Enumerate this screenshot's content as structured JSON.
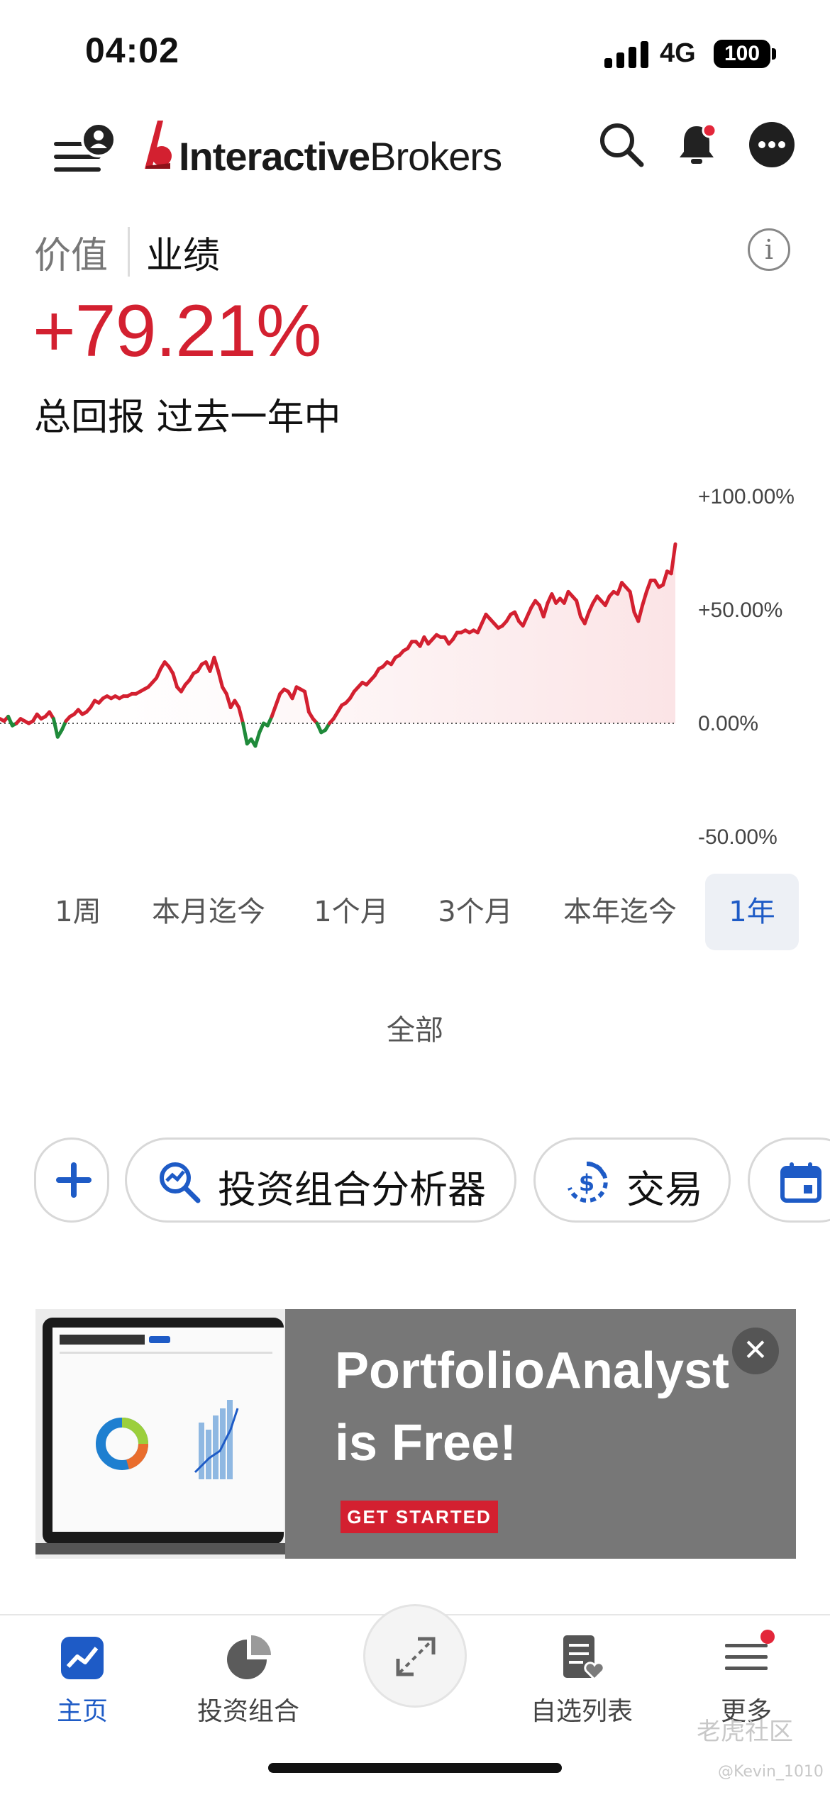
{
  "status_bar": {
    "time": "04:02",
    "network": "4G",
    "battery": "100"
  },
  "header": {
    "logo_bold": "Interactive",
    "logo_regular": "Brokers"
  },
  "tabs": {
    "value_label": "价值",
    "performance_label": "业绩"
  },
  "summary": {
    "return_value": "+79.21%",
    "description": "总回报 过去一年中"
  },
  "chart_data": {
    "type": "line",
    "y_tick_labels": [
      "+100.00%",
      "+50.00%",
      "0.00%",
      "-50.00%"
    ],
    "ylim": [
      -50,
      100
    ],
    "baseline": 0,
    "series": [
      {
        "values": [
          2,
          1,
          3,
          -1,
          0,
          2,
          1,
          0,
          1,
          4,
          2,
          3,
          5,
          2,
          -6,
          -3,
          1,
          3,
          4,
          6,
          4,
          5,
          7,
          10,
          9,
          11,
          12,
          11,
          12,
          11,
          12,
          12,
          13,
          13,
          14,
          15,
          16,
          18,
          20,
          24,
          27,
          25,
          22,
          16,
          14,
          17,
          19,
          22,
          23,
          26,
          27,
          23,
          29,
          23,
          16,
          13,
          7,
          10,
          7,
          0,
          -9,
          -7,
          -10,
          -4,
          0,
          -1,
          3,
          8,
          13,
          15,
          14,
          11,
          16,
          15,
          14,
          5,
          2,
          0,
          -4,
          -3,
          0,
          2,
          5,
          8,
          9,
          11,
          14,
          16,
          18,
          17,
          19,
          21,
          24,
          25,
          27,
          26,
          29,
          30,
          32,
          33,
          36,
          36,
          34,
          38,
          35,
          37,
          39,
          38,
          38,
          35,
          37,
          40,
          40,
          41,
          40,
          41,
          40,
          44,
          48,
          46,
          44,
          42,
          43,
          45,
          48,
          49,
          45,
          43,
          47,
          51,
          54,
          52,
          47,
          53,
          57,
          53,
          55,
          53,
          58,
          56,
          54,
          47,
          44,
          49,
          53,
          56,
          54,
          52,
          56,
          58,
          57,
          62,
          60,
          58,
          49,
          45,
          52,
          58,
          63,
          63,
          60,
          61,
          67,
          66,
          79
        ]
      }
    ],
    "legend": "none",
    "grid": "off",
    "colors": {
      "positive": "#d32030",
      "negative": "#1f8a3a",
      "fill": "#fbe4e6"
    }
  },
  "range_selector": {
    "options": [
      "1周",
      "本月迄今",
      "1个月",
      "3个月",
      "本年迄今",
      "1年"
    ],
    "selected": "1年",
    "all_label": "全部"
  },
  "actions": [
    {
      "icon": "plus-icon",
      "label": ""
    },
    {
      "icon": "portfolio-analyzer-icon",
      "label": "投资组合分析器"
    },
    {
      "icon": "trade-icon",
      "label": "交易"
    },
    {
      "icon": "calendar-icon",
      "label": ""
    }
  ],
  "banner": {
    "title_line1": "PortfolioAnalyst",
    "title_line2": "is Free!",
    "cta": "GET STARTED",
    "close": "✕"
  },
  "bottom_nav": {
    "items": [
      {
        "label": "主页",
        "icon": "home-chart-icon",
        "active": true
      },
      {
        "label": "投资组合",
        "icon": "pie-chart-icon",
        "active": false
      },
      {
        "label": "自选列表",
        "icon": "watchlist-icon",
        "active": false
      },
      {
        "label": "更多",
        "icon": "menu-icon",
        "active": false,
        "badge": true
      }
    ],
    "center_icon": "expand-arrows-icon"
  },
  "watermark": {
    "line1": "老虎社区",
    "line2": "@Kevin_1010"
  },
  "colors": {
    "brand_red": "#d32030",
    "accent_blue": "#1e5bc6",
    "gain_green": "#1f8a3a"
  }
}
